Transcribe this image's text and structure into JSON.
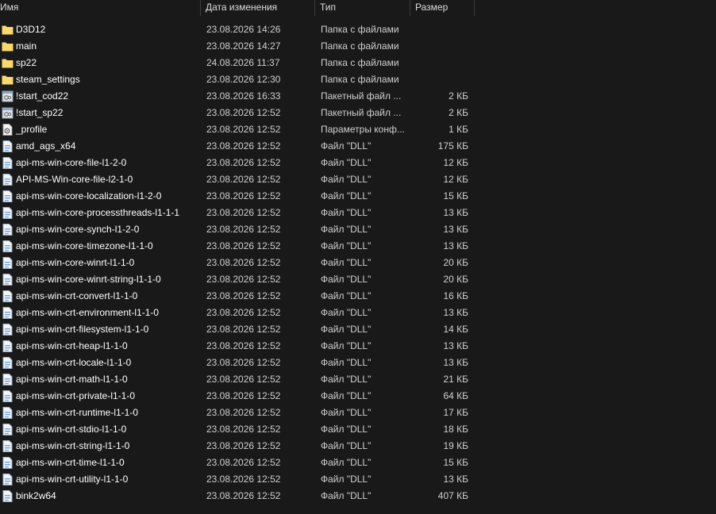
{
  "columns": {
    "name": "Имя",
    "date": "Дата изменения",
    "type": "Тип",
    "size": "Размер"
  },
  "colors": {
    "background": "#191919",
    "folder": "#f8d775",
    "dll_icon": "#6fa3d8",
    "text": "#ffffff",
    "muted_text": "#d0d0d0"
  },
  "files": [
    {
      "name": "D3D12",
      "date": "23.08.2026 14:26",
      "type": "Папка с файлами",
      "size": "",
      "icon": "folder-icon"
    },
    {
      "name": "main",
      "date": "23.08.2026 14:27",
      "type": "Папка с файлами",
      "size": "",
      "icon": "folder-icon"
    },
    {
      "name": "sp22",
      "date": "24.08.2026 11:37",
      "type": "Папка с файлами",
      "size": "",
      "icon": "folder-icon"
    },
    {
      "name": "steam_settings",
      "date": "23.08.2026 12:30",
      "type": "Папка с файлами",
      "size": "",
      "icon": "folder-icon"
    },
    {
      "name": "!start_cod22",
      "date": "23.08.2026 16:33",
      "type": "Пакетный файл ...",
      "size": "2 КБ",
      "icon": "batch-file-icon"
    },
    {
      "name": "!start_sp22",
      "date": "23.08.2026 12:52",
      "type": "Пакетный файл ...",
      "size": "2 КБ",
      "icon": "batch-file-icon"
    },
    {
      "name": "_profile",
      "date": "23.08.2026 12:52",
      "type": "Параметры конф...",
      "size": "1 КБ",
      "icon": "config-file-icon"
    },
    {
      "name": "amd_ags_x64",
      "date": "23.08.2026 12:52",
      "type": "Файл \"DLL\"",
      "size": "175 КБ",
      "icon": "dll-file-icon"
    },
    {
      "name": "api-ms-win-core-file-l1-2-0",
      "date": "23.08.2026 12:52",
      "type": "Файл \"DLL\"",
      "size": "12 КБ",
      "icon": "dll-file-icon"
    },
    {
      "name": "API-MS-Win-core-file-l2-1-0",
      "date": "23.08.2026 12:52",
      "type": "Файл \"DLL\"",
      "size": "12 КБ",
      "icon": "dll-file-icon"
    },
    {
      "name": "api-ms-win-core-localization-l1-2-0",
      "date": "23.08.2026 12:52",
      "type": "Файл \"DLL\"",
      "size": "15 КБ",
      "icon": "dll-file-icon"
    },
    {
      "name": "api-ms-win-core-processthreads-l1-1-1",
      "date": "23.08.2026 12:52",
      "type": "Файл \"DLL\"",
      "size": "13 КБ",
      "icon": "dll-file-icon"
    },
    {
      "name": "api-ms-win-core-synch-l1-2-0",
      "date": "23.08.2026 12:52",
      "type": "Файл \"DLL\"",
      "size": "13 КБ",
      "icon": "dll-file-icon"
    },
    {
      "name": "api-ms-win-core-timezone-l1-1-0",
      "date": "23.08.2026 12:52",
      "type": "Файл \"DLL\"",
      "size": "13 КБ",
      "icon": "dll-file-icon"
    },
    {
      "name": "api-ms-win-core-winrt-l1-1-0",
      "date": "23.08.2026 12:52",
      "type": "Файл \"DLL\"",
      "size": "20 КБ",
      "icon": "dll-file-icon"
    },
    {
      "name": "api-ms-win-core-winrt-string-l1-1-0",
      "date": "23.08.2026 12:52",
      "type": "Файл \"DLL\"",
      "size": "20 КБ",
      "icon": "dll-file-icon"
    },
    {
      "name": "api-ms-win-crt-convert-l1-1-0",
      "date": "23.08.2026 12:52",
      "type": "Файл \"DLL\"",
      "size": "16 КБ",
      "icon": "dll-file-icon"
    },
    {
      "name": "api-ms-win-crt-environment-l1-1-0",
      "date": "23.08.2026 12:52",
      "type": "Файл \"DLL\"",
      "size": "13 КБ",
      "icon": "dll-file-icon"
    },
    {
      "name": "api-ms-win-crt-filesystem-l1-1-0",
      "date": "23.08.2026 12:52",
      "type": "Файл \"DLL\"",
      "size": "14 КБ",
      "icon": "dll-file-icon"
    },
    {
      "name": "api-ms-win-crt-heap-l1-1-0",
      "date": "23.08.2026 12:52",
      "type": "Файл \"DLL\"",
      "size": "13 КБ",
      "icon": "dll-file-icon"
    },
    {
      "name": "api-ms-win-crt-locale-l1-1-0",
      "date": "23.08.2026 12:52",
      "type": "Файл \"DLL\"",
      "size": "13 КБ",
      "icon": "dll-file-icon"
    },
    {
      "name": "api-ms-win-crt-math-l1-1-0",
      "date": "23.08.2026 12:52",
      "type": "Файл \"DLL\"",
      "size": "21 КБ",
      "icon": "dll-file-icon"
    },
    {
      "name": "api-ms-win-crt-private-l1-1-0",
      "date": "23.08.2026 12:52",
      "type": "Файл \"DLL\"",
      "size": "64 КБ",
      "icon": "dll-file-icon"
    },
    {
      "name": "api-ms-win-crt-runtime-l1-1-0",
      "date": "23.08.2026 12:52",
      "type": "Файл \"DLL\"",
      "size": "17 КБ",
      "icon": "dll-file-icon"
    },
    {
      "name": "api-ms-win-crt-stdio-l1-1-0",
      "date": "23.08.2026 12:52",
      "type": "Файл \"DLL\"",
      "size": "18 КБ",
      "icon": "dll-file-icon"
    },
    {
      "name": "api-ms-win-crt-string-l1-1-0",
      "date": "23.08.2026 12:52",
      "type": "Файл \"DLL\"",
      "size": "19 КБ",
      "icon": "dll-file-icon"
    },
    {
      "name": "api-ms-win-crt-time-l1-1-0",
      "date": "23.08.2026 12:52",
      "type": "Файл \"DLL\"",
      "size": "15 КБ",
      "icon": "dll-file-icon"
    },
    {
      "name": "api-ms-win-crt-utility-l1-1-0",
      "date": "23.08.2026 12:52",
      "type": "Файл \"DLL\"",
      "size": "13 КБ",
      "icon": "dll-file-icon"
    },
    {
      "name": "bink2w64",
      "date": "23.08.2026 12:52",
      "type": "Файл \"DLL\"",
      "size": "407 КБ",
      "icon": "dll-file-icon"
    }
  ]
}
